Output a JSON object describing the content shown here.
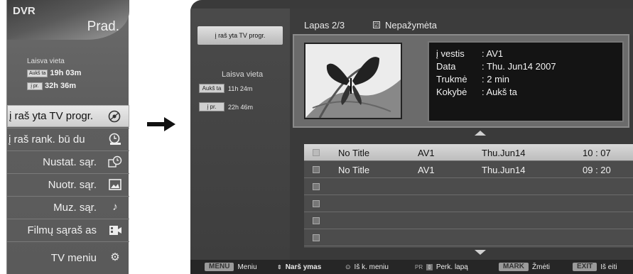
{
  "left_menu": {
    "title": "DVR",
    "subtitle": "Prad.",
    "free_space_label": "Laisva vieta",
    "memory": [
      {
        "badge": "Aukš ta",
        "value": "19h 03m"
      },
      {
        "badge": "į pr.",
        "value": "32h 36m"
      }
    ],
    "items": [
      {
        "label": "į raš yta TV progr.",
        "icon": "disc-icon"
      },
      {
        "label": "į raš rank. bū du",
        "icon": "manual-record-icon"
      },
      {
        "label": "Nustat. sąr.",
        "icon": "schedule-icon"
      },
      {
        "label": "Nuotr. sąr.",
        "icon": "photo-icon"
      },
      {
        "label": "Muz. sąr.",
        "icon": "music-note-icon"
      },
      {
        "label": "Filmų sąraš as",
        "icon": "movie-icon"
      },
      {
        "label": "TV meniu",
        "icon": "settings-gears-icon"
      }
    ]
  },
  "screen": {
    "side_tab": "į raš yta TV progr.",
    "free_space_label": "Laisva vieta",
    "memory": [
      {
        "badge": "Aukš ta",
        "value": "11h 24m"
      },
      {
        "badge": "į pr.",
        "value": "22h 46m"
      }
    ],
    "page_label": "Lapas 2/3",
    "unmark_label": "Nepažymėta",
    "info": {
      "input_key": "į vestis",
      "input_val": ": AV1",
      "date_key": "Data",
      "date_val": ": Thu. Jun14 2007",
      "dur_key": "Trukmė",
      "dur_val": ": 2 min",
      "qual_key": "Kokybė",
      "qual_val": ": Aukš ta"
    },
    "rows": [
      {
        "title": "No Title",
        "input": "AV1",
        "date": "Thu.Jun14",
        "time": "10 : 07"
      },
      {
        "title": "No Title",
        "input": "AV1",
        "date": "Thu.Jun14",
        "time": "09 : 20"
      },
      {
        "title": "",
        "input": "",
        "date": "",
        "time": ""
      },
      {
        "title": "",
        "input": "",
        "date": "",
        "time": ""
      },
      {
        "title": "",
        "input": "",
        "date": "",
        "time": ""
      },
      {
        "title": "",
        "input": "",
        "date": "",
        "time": ""
      }
    ],
    "footer": {
      "menu_key": "MENU",
      "menu_label": "Meniu",
      "nav_label": "Narš ymas",
      "exit_menu_label": "Iš k. meniu",
      "pr_key": "PR",
      "page_label": "Perk. lapą",
      "mark_key": "MARK",
      "mark_label": "Žmėti",
      "exit_key": "EXIT",
      "exit_label": "Iš eiti"
    }
  }
}
